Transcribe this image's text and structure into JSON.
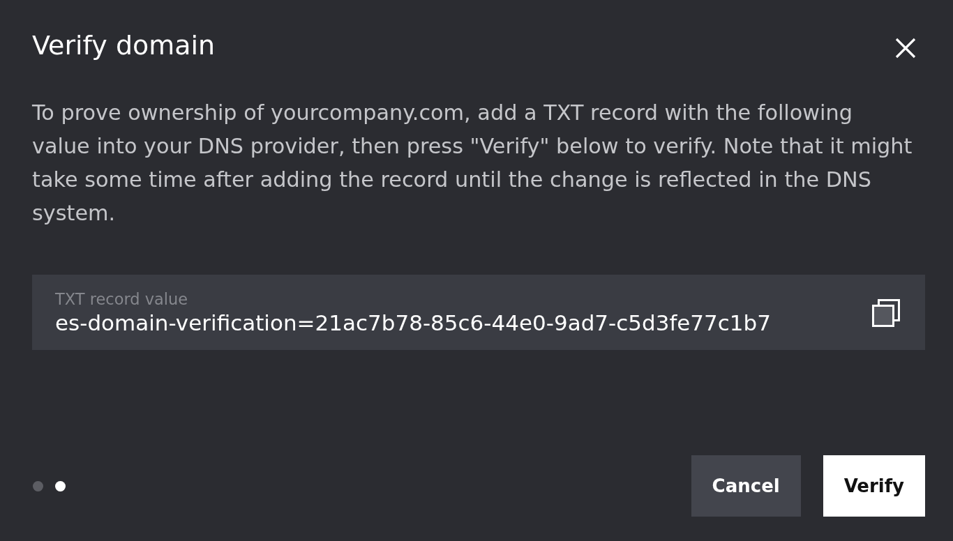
{
  "dialog": {
    "title": "Verify domain"
  },
  "description": "To prove ownership of yourcompany.com, add a TXT record with the following value into your DNS provider, then press \"Verify\" below to verify. Note that it might take some time after adding the record until the change is reflected in the DNS system.",
  "record_field": {
    "label": "TXT record value",
    "value": "es-domain-verification=21ac7b78-85c6-44e0-9ad7-c5d3fe77c1b7"
  },
  "steps": [
    {
      "selected": false
    },
    {
      "selected": true
    }
  ],
  "buttons": [
    {
      "label": "Cancel",
      "kind": "secondary"
    },
    {
      "label": "Verify",
      "kind": "primary"
    }
  ]
}
